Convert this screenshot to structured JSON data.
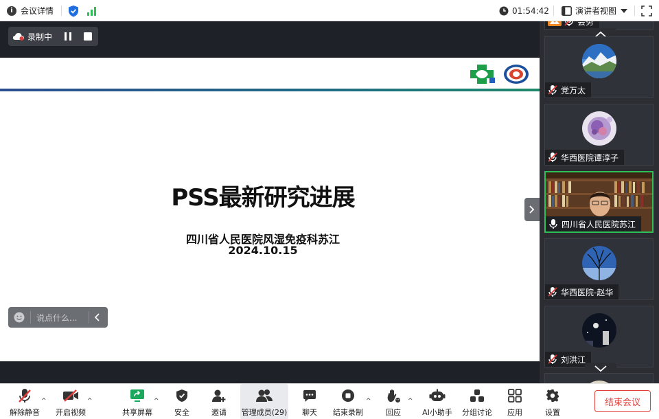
{
  "topbar": {
    "meeting_details": "会议详情",
    "timer": "01:54:42",
    "view_mode": "演讲者视图"
  },
  "recording": {
    "label": "录制中"
  },
  "slide": {
    "title": "PSS最新研究进展",
    "subtitle_line1": "四川省人民医院风湿免疫科苏江",
    "subtitle_line2": "2024.10.15"
  },
  "chat": {
    "placeholder": "说点什么..."
  },
  "gallery": {
    "partial_top_name": "会务",
    "participants": [
      {
        "name": "党万太",
        "avatar": "mountain-lake",
        "muted": true
      },
      {
        "name": "华西医院谭淳子",
        "avatar": "cell-microscopy",
        "muted": true
      },
      {
        "name": "四川省人民医院苏江",
        "avatar": "video-bookshelf",
        "muted": false,
        "active": true
      },
      {
        "name": "华西医院-赵华",
        "avatar": "tree-night-sky",
        "muted": true
      },
      {
        "name": "刘洪江",
        "avatar": "space-photo",
        "muted": true
      }
    ]
  },
  "toolbar": {
    "unmute": "解除静音",
    "start_video": "开启视频",
    "share_screen": "共享屏幕",
    "security": "安全",
    "invite": "邀请",
    "manage_members": "管理成员(29)",
    "chat": "聊天",
    "end_recording": "结束录制",
    "react": "回应",
    "ai_assistant": "AI小助手",
    "breakout": "分组讨论",
    "apps": "应用",
    "settings": "设置",
    "end_meeting": "结束会议"
  },
  "colors": {
    "accent_green": "#2fbf57",
    "end_red": "#e0403a",
    "share_green": "#1aa85c",
    "muted_red": "#e03c3c"
  }
}
